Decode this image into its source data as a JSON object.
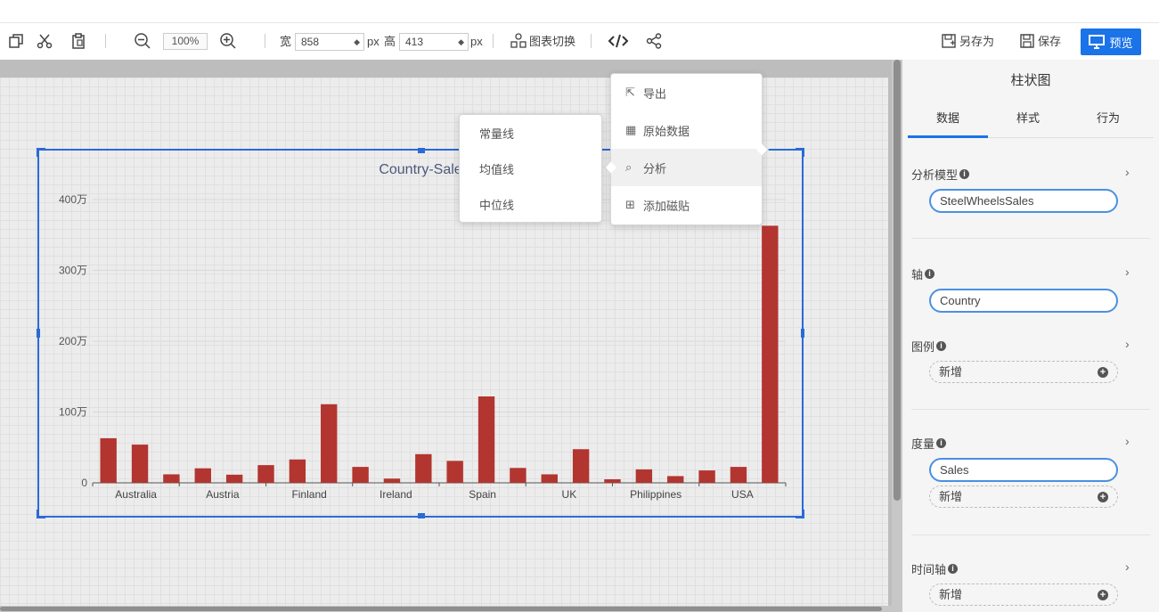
{
  "toolbar": {
    "zoom": "100%",
    "width_label": "宽",
    "width_value": "858",
    "height_label": "高",
    "height_value": "413",
    "unit": "px",
    "chart_switch": "图表切换",
    "save_as": "另存为",
    "save": "保存",
    "preview": "预览"
  },
  "context_menu": {
    "items": [
      "导出",
      "原始数据",
      "分析",
      "添加磁贴"
    ]
  },
  "analysis_submenu": {
    "items": [
      "常量线",
      "均值线",
      "中位线"
    ]
  },
  "panel": {
    "title": "柱状图",
    "tabs": [
      "数据",
      "样式",
      "行为"
    ],
    "add_label": "新增",
    "sections": {
      "model": {
        "label": "分析模型",
        "value": "SteelWheelsSales"
      },
      "axis": {
        "label": "轴",
        "value": "Country"
      },
      "legend": {
        "label": "图例"
      },
      "measure": {
        "label": "度量",
        "value": "Sales"
      },
      "timeline": {
        "label": "时间轴"
      }
    }
  },
  "chart_data": {
    "type": "bar",
    "title": "Country-Sale",
    "ylabel": "",
    "xlabel": "",
    "ylim": [
      0,
      4000000
    ],
    "yticks": [
      0,
      1000000,
      2000000,
      3000000,
      4000000
    ],
    "ytick_labels": [
      "0",
      "100万",
      "200万",
      "300万",
      "400万"
    ],
    "xtick_labels": [
      "Australia",
      "Austria",
      "Finland",
      "Ireland",
      "Spain",
      "UK",
      "Philippines",
      "USA"
    ],
    "values": [
      630000,
      540000,
      120000,
      205000,
      115000,
      250000,
      330000,
      1110000,
      225000,
      60000,
      405000,
      310000,
      1220000,
      210000,
      120000,
      475000,
      50000,
      190000,
      95000,
      175000,
      225000,
      3630000
    ],
    "bar_color": "#b33530",
    "grid": true
  }
}
